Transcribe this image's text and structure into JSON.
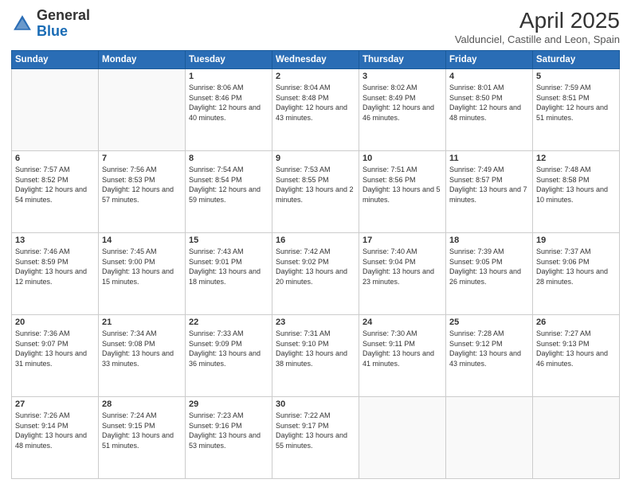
{
  "logo": {
    "general": "General",
    "blue": "Blue"
  },
  "title": {
    "month": "April 2025",
    "location": "Valdunciel, Castille and Leon, Spain"
  },
  "weekdays": [
    "Sunday",
    "Monday",
    "Tuesday",
    "Wednesday",
    "Thursday",
    "Friday",
    "Saturday"
  ],
  "weeks": [
    [
      {
        "day": "",
        "info": ""
      },
      {
        "day": "",
        "info": ""
      },
      {
        "day": "1",
        "info": "Sunrise: 8:06 AM\nSunset: 8:46 PM\nDaylight: 12 hours and 40 minutes."
      },
      {
        "day": "2",
        "info": "Sunrise: 8:04 AM\nSunset: 8:48 PM\nDaylight: 12 hours and 43 minutes."
      },
      {
        "day": "3",
        "info": "Sunrise: 8:02 AM\nSunset: 8:49 PM\nDaylight: 12 hours and 46 minutes."
      },
      {
        "day": "4",
        "info": "Sunrise: 8:01 AM\nSunset: 8:50 PM\nDaylight: 12 hours and 48 minutes."
      },
      {
        "day": "5",
        "info": "Sunrise: 7:59 AM\nSunset: 8:51 PM\nDaylight: 12 hours and 51 minutes."
      }
    ],
    [
      {
        "day": "6",
        "info": "Sunrise: 7:57 AM\nSunset: 8:52 PM\nDaylight: 12 hours and 54 minutes."
      },
      {
        "day": "7",
        "info": "Sunrise: 7:56 AM\nSunset: 8:53 PM\nDaylight: 12 hours and 57 minutes."
      },
      {
        "day": "8",
        "info": "Sunrise: 7:54 AM\nSunset: 8:54 PM\nDaylight: 12 hours and 59 minutes."
      },
      {
        "day": "9",
        "info": "Sunrise: 7:53 AM\nSunset: 8:55 PM\nDaylight: 13 hours and 2 minutes."
      },
      {
        "day": "10",
        "info": "Sunrise: 7:51 AM\nSunset: 8:56 PM\nDaylight: 13 hours and 5 minutes."
      },
      {
        "day": "11",
        "info": "Sunrise: 7:49 AM\nSunset: 8:57 PM\nDaylight: 13 hours and 7 minutes."
      },
      {
        "day": "12",
        "info": "Sunrise: 7:48 AM\nSunset: 8:58 PM\nDaylight: 13 hours and 10 minutes."
      }
    ],
    [
      {
        "day": "13",
        "info": "Sunrise: 7:46 AM\nSunset: 8:59 PM\nDaylight: 13 hours and 12 minutes."
      },
      {
        "day": "14",
        "info": "Sunrise: 7:45 AM\nSunset: 9:00 PM\nDaylight: 13 hours and 15 minutes."
      },
      {
        "day": "15",
        "info": "Sunrise: 7:43 AM\nSunset: 9:01 PM\nDaylight: 13 hours and 18 minutes."
      },
      {
        "day": "16",
        "info": "Sunrise: 7:42 AM\nSunset: 9:02 PM\nDaylight: 13 hours and 20 minutes."
      },
      {
        "day": "17",
        "info": "Sunrise: 7:40 AM\nSunset: 9:04 PM\nDaylight: 13 hours and 23 minutes."
      },
      {
        "day": "18",
        "info": "Sunrise: 7:39 AM\nSunset: 9:05 PM\nDaylight: 13 hours and 26 minutes."
      },
      {
        "day": "19",
        "info": "Sunrise: 7:37 AM\nSunset: 9:06 PM\nDaylight: 13 hours and 28 minutes."
      }
    ],
    [
      {
        "day": "20",
        "info": "Sunrise: 7:36 AM\nSunset: 9:07 PM\nDaylight: 13 hours and 31 minutes."
      },
      {
        "day": "21",
        "info": "Sunrise: 7:34 AM\nSunset: 9:08 PM\nDaylight: 13 hours and 33 minutes."
      },
      {
        "day": "22",
        "info": "Sunrise: 7:33 AM\nSunset: 9:09 PM\nDaylight: 13 hours and 36 minutes."
      },
      {
        "day": "23",
        "info": "Sunrise: 7:31 AM\nSunset: 9:10 PM\nDaylight: 13 hours and 38 minutes."
      },
      {
        "day": "24",
        "info": "Sunrise: 7:30 AM\nSunset: 9:11 PM\nDaylight: 13 hours and 41 minutes."
      },
      {
        "day": "25",
        "info": "Sunrise: 7:28 AM\nSunset: 9:12 PM\nDaylight: 13 hours and 43 minutes."
      },
      {
        "day": "26",
        "info": "Sunrise: 7:27 AM\nSunset: 9:13 PM\nDaylight: 13 hours and 46 minutes."
      }
    ],
    [
      {
        "day": "27",
        "info": "Sunrise: 7:26 AM\nSunset: 9:14 PM\nDaylight: 13 hours and 48 minutes."
      },
      {
        "day": "28",
        "info": "Sunrise: 7:24 AM\nSunset: 9:15 PM\nDaylight: 13 hours and 51 minutes."
      },
      {
        "day": "29",
        "info": "Sunrise: 7:23 AM\nSunset: 9:16 PM\nDaylight: 13 hours and 53 minutes."
      },
      {
        "day": "30",
        "info": "Sunrise: 7:22 AM\nSunset: 9:17 PM\nDaylight: 13 hours and 55 minutes."
      },
      {
        "day": "",
        "info": ""
      },
      {
        "day": "",
        "info": ""
      },
      {
        "day": "",
        "info": ""
      }
    ]
  ]
}
